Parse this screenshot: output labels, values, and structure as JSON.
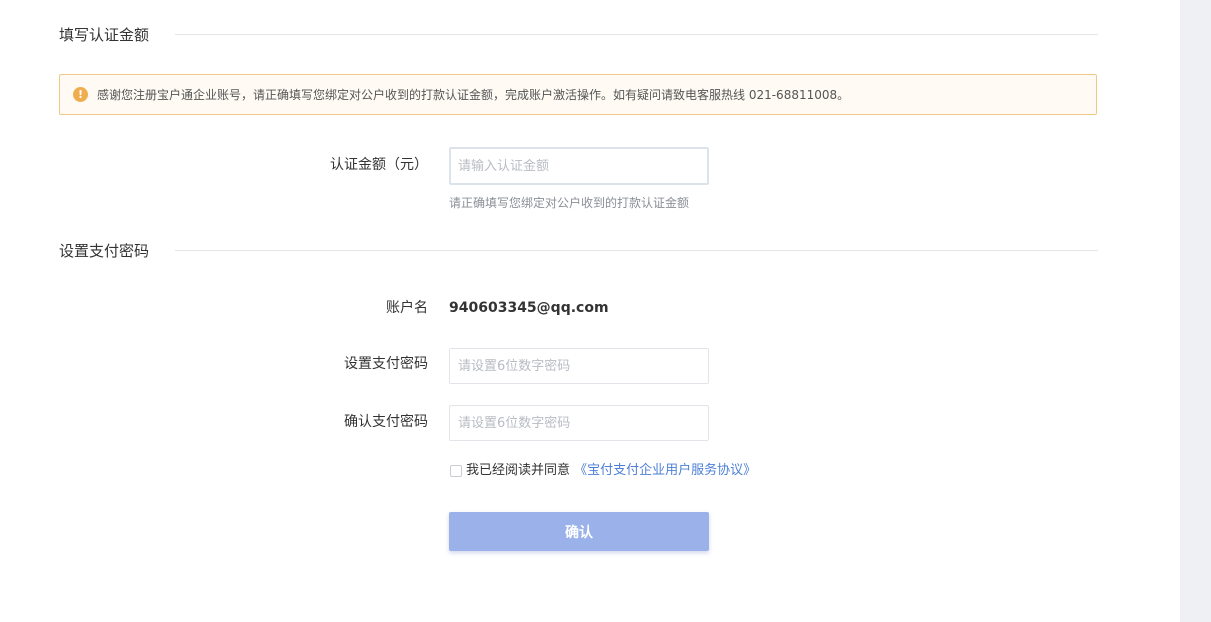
{
  "sections": {
    "amount_title": "填写认证金额",
    "password_title": "设置支付密码"
  },
  "notice": {
    "icon": "!",
    "text": "感谢您注册宝户通企业账号，请正确填写您绑定对公户收到的打款认证金额，完成账户激活操作。如有疑问请致电客服热线 021-68811008。"
  },
  "amount": {
    "label": "认证金额（元）",
    "placeholder": "请输入认证金额",
    "hint": "请正确填写您绑定对公户收到的打款认证金额"
  },
  "account": {
    "label": "账户名",
    "value": "940603345@qq.com"
  },
  "password": {
    "label": "设置支付密码",
    "placeholder": "请设置6位数字密码"
  },
  "confirm_password": {
    "label": "确认支付密码",
    "placeholder": "请设置6位数字密码"
  },
  "agreement": {
    "prefix": "我已经阅读并同意",
    "link": "《宝付支付企业用户服务协议》",
    "checked": false
  },
  "submit": {
    "label": "确认"
  }
}
